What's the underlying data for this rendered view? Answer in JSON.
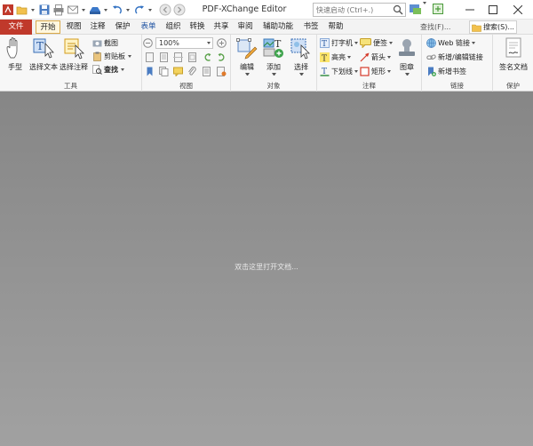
{
  "window": {
    "title": "PDF-XChange Editor",
    "quick_launch_placeholder": "快速启动 (Ctrl+.)",
    "controls": [
      "minimize-icon",
      "maximize-icon",
      "close-icon"
    ]
  },
  "tabs": [
    {
      "label": "文件",
      "kind": "file"
    },
    {
      "label": "开始",
      "kind": "active"
    },
    {
      "label": "视图"
    },
    {
      "label": "注释"
    },
    {
      "label": "保护"
    },
    {
      "label": "表单",
      "kind": "blue"
    },
    {
      "label": "组织"
    },
    {
      "label": "转换"
    },
    {
      "label": "共享"
    },
    {
      "label": "审阅"
    },
    {
      "label": "辅助功能"
    },
    {
      "label": "书签"
    },
    {
      "label": "帮助"
    }
  ],
  "tabbar_right": {
    "find_label": "查找(F)...",
    "search_label": "搜索(S)..."
  },
  "ribbon": {
    "tools": {
      "label": "工具",
      "hand": "手型",
      "select_text": "选择文本",
      "select_comment": "选择注释",
      "snapshot": "截图",
      "clipboard": "剪贴板",
      "find": "查找"
    },
    "view": {
      "label": "视图",
      "zoom": "100%"
    },
    "objects": {
      "label": "对象",
      "edit": "编辑",
      "add": "添加",
      "select": "选择"
    },
    "comment": {
      "label": "注释",
      "typewriter": "打字机",
      "note": "便签",
      "highlight": "高亮",
      "arrow": "箭头",
      "underline": "下划线",
      "rectangle": "矩形",
      "stamp": "图章"
    },
    "links": {
      "label": "链接",
      "web_links": "Web 链接",
      "add_edit_link": "新增/编辑链接",
      "add_bookmark": "新增书签"
    },
    "protect": {
      "label": "保护",
      "sign": "签名文档"
    }
  },
  "document": {
    "hint": "双击这里打开文档..."
  },
  "colors": {
    "file_tab": "#c0392b",
    "active_tab_border": "#d8a94a",
    "doc_background": "#8f8f8f"
  }
}
